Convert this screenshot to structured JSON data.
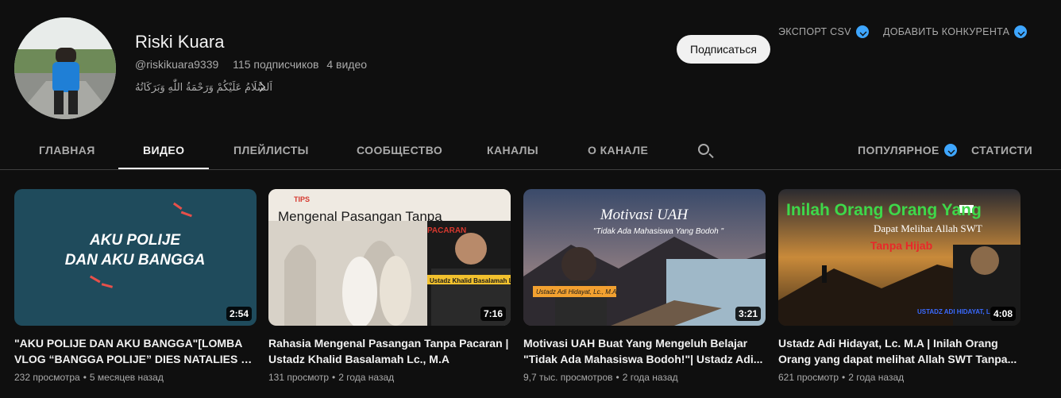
{
  "channel": {
    "name": "Riski Kuara",
    "handle": "@riskikuara9339",
    "subscribers": "115 подписчиков",
    "video_count": "4 видео",
    "description": "اَلسَّلَامُ عَلَيْكُمْ وَرَحْمَةُ اللّٰهِ وَبَرَكَاتُهُ",
    "subscribe_label": "Подписаться"
  },
  "extension": {
    "export_csv": "ЭКСПОРТ CSV",
    "add_competitor": "ДОБАВИТЬ КОНКУРЕНТА"
  },
  "tabs": {
    "home": "ГЛАВНАЯ",
    "videos": "ВИДЕО",
    "playlists": "ПЛЕЙЛИСТЫ",
    "community": "СООБЩЕСТВО",
    "channels": "КАНАЛЫ",
    "about": "О КАНАЛЕ",
    "popular": "ПОПУЛЯРНОЕ",
    "stats": "СТАТИСТИ"
  },
  "videos": [
    {
      "title": "\"AKU POLIJE DAN AKU BANGGA\"[LOMBA VLOG “BANGGA POLIJE” DIES NATALIES KE ...",
      "duration": "2:54",
      "views": "232 просмотра",
      "age": "5 месяцев назад",
      "thumb_text": [
        "AKU POLIJE",
        "DAN AKU BANGGA"
      ]
    },
    {
      "title": "Rahasia Mengenal Pasangan Tanpa Pacaran | Ustadz Khalid Basalamah Lc., M.A",
      "duration": "7:16",
      "views": "131 просмотр",
      "age": "2 года назад",
      "thumb_text": [
        "TIPS",
        "Mengenal Pasangan Tanpa",
        "PACARAN",
        "Ustadz Khalid Basalamah Lc., M.A"
      ]
    },
    {
      "title": "Motivasi UAH Buat Yang Mengeluh Belajar \"Tidak Ada Mahasiswa Bodoh!\"| Ustadz Adi...",
      "duration": "3:21",
      "views": "9,7 тыс. просмотров",
      "age": "2 года назад",
      "thumb_text": [
        "Motivasi UAH",
        "\"Tidak Ada Mahasiswa Yang Bodoh \"",
        "Ustadz Adi Hidayat, Lc., M.A"
      ]
    },
    {
      "title": "Ustadz Adi Hidayat, Lc. M.A | Inilah Orang Orang yang dapat melihat Allah SWT Tanpa...",
      "duration": "4:08",
      "views": "621 просмотр",
      "age": "2 года назад",
      "thumb_text": [
        "Inilah Orang Orang Yang",
        "Dapat Melihat Allah SWT",
        "Tanpa Hijab",
        "USTADZ ADI HIDAYAT, L"
      ]
    }
  ],
  "separator": "•",
  "colors": {
    "background": "#0f0f0f",
    "accent": "#3ea6ff",
    "text": "#f1f1f1",
    "muted": "#aaaaaa"
  }
}
